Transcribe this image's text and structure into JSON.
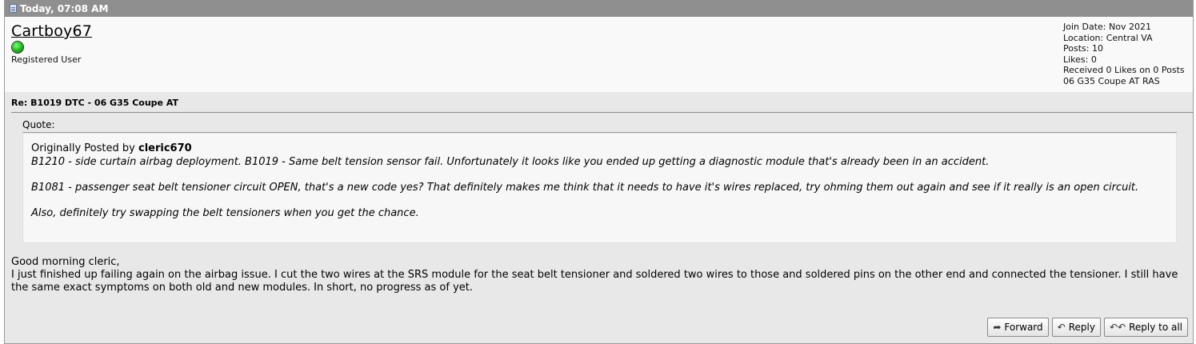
{
  "post": {
    "date": "Today, 07:08 AM",
    "title": "Re: B1019 DTC - 06 G35 Coupe AT"
  },
  "user": {
    "username": "Cartboy67",
    "title": "Registered User",
    "join_date": "Join Date: Nov 2021",
    "location": "Location: Central VA",
    "posts": "Posts: 10",
    "likes": "Likes: 0",
    "received_likes": "Received 0 Likes on 0 Posts",
    "signature": "06 G35 Coupe AT RAS"
  },
  "quote": {
    "label": "Quote:",
    "originally_posted_by": "Originally Posted by",
    "author": "cleric670",
    "paragraphs": [
      "B1210 - side curtain airbag deployment. B1019 - Same belt tension sensor fail. Unfortunately it looks like you ended up getting a diagnostic module that's already been in an accident.",
      "B1081 - passenger seat belt tensioner circuit OPEN, that's a new code yes? That definitely makes me think that it needs to have it's wires replaced, try ohming them out again and see if it really is an open circuit.",
      "Also, definitely try swapping the belt tensioners when you get the chance."
    ]
  },
  "message": {
    "greeting": "Good morning cleric,",
    "body": "I just finished up failing again on the airbag issue. I cut the two wires at the SRS module for the seat belt tensioner and soldered two wires to those and soldered pins on the other end and connected the tensioner. I still have the same exact symptoms on both old and new modules. In short, no progress as of yet."
  },
  "buttons": {
    "forward": "Forward",
    "reply": "Reply",
    "reply_all": "Reply to all"
  },
  "icons": {
    "post_icon": "document-icon",
    "online": "online-status-icon",
    "forward": "forward-arrow-icon",
    "reply": "reply-arrow-icon",
    "reply_all": "reply-all-arrow-icon"
  },
  "colors": {
    "header_bg": "#8f8f8f",
    "post_bg": "#e8e8e8",
    "userbar_bg": "#f9f9f9",
    "quote_bg": "#f7f7f7",
    "online": "#15b815"
  }
}
